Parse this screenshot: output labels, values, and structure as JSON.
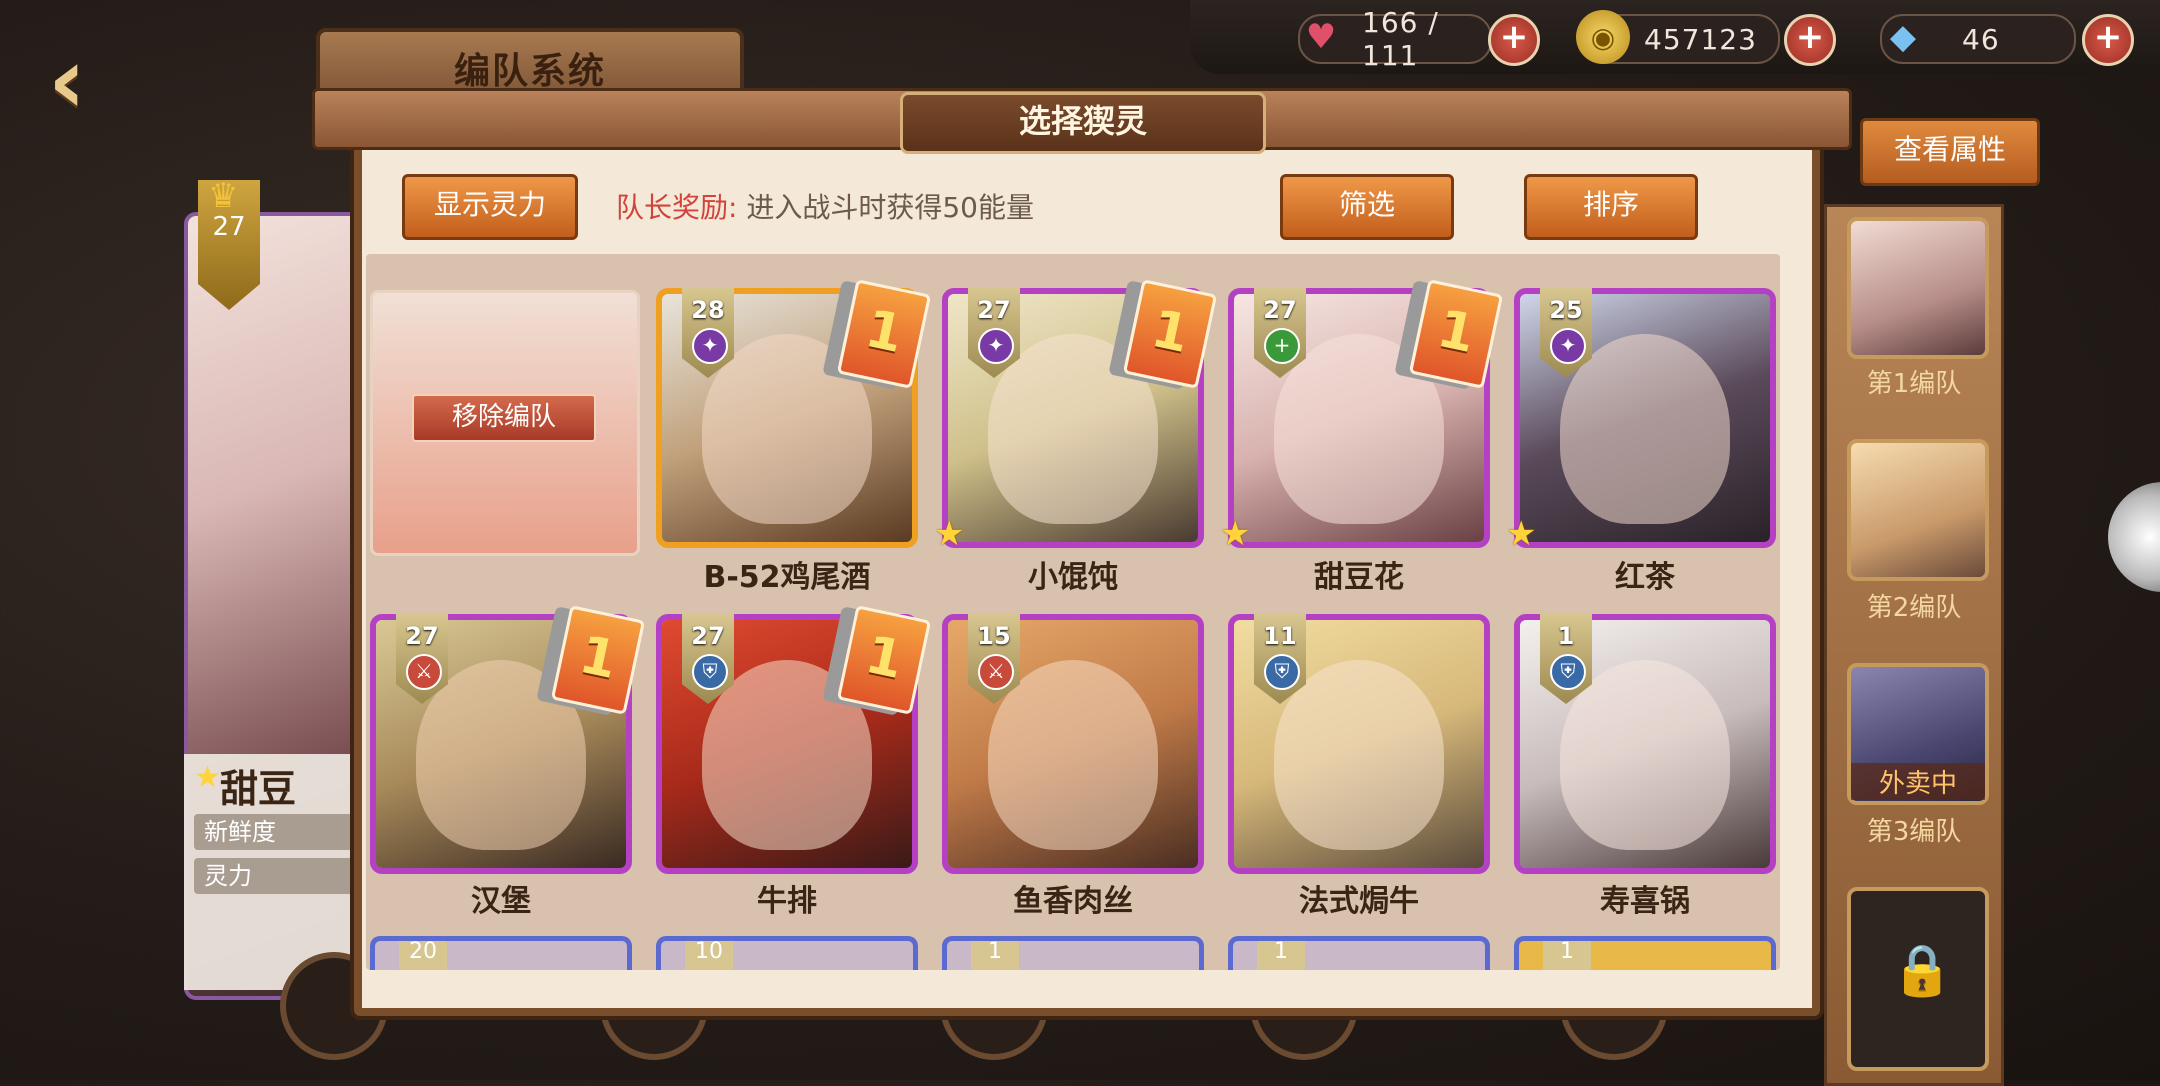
{
  "header": {
    "screen_title": "编队系统",
    "resources": [
      {
        "icon": "heart-icon",
        "value": "166 / 111"
      },
      {
        "icon": "gold-coin-icon",
        "value": "457123"
      },
      {
        "icon": "crystal-icon",
        "value": "46"
      }
    ]
  },
  "left_card": {
    "level": "27",
    "name": "甜豆",
    "stat1_label": "新鲜度",
    "stat2_label": "灵力"
  },
  "panel": {
    "title": "选择猰灵",
    "show_power_label": "显示灵力",
    "leader_bonus_label": "队长奖励:",
    "leader_bonus_text": "进入战斗时获得50能量",
    "filter_label": "筛选",
    "sort_label": "排序",
    "remove_label": "移除编队"
  },
  "characters": [
    {
      "name": "B-52鸡尾酒",
      "level": "28",
      "class": "purple",
      "deck": "1",
      "star": false,
      "frame": "gold"
    },
    {
      "name": "小馄饨",
      "level": "27",
      "class": "purple",
      "deck": "1",
      "star": true,
      "frame": "purple"
    },
    {
      "name": "甜豆花",
      "level": "27",
      "class": "green",
      "deck": "1",
      "star": true,
      "frame": "purple"
    },
    {
      "name": "红茶",
      "level": "25",
      "class": "purple",
      "deck": "",
      "star": true,
      "frame": "purple"
    },
    {
      "name": "汉堡",
      "level": "27",
      "class": "red",
      "deck": "1",
      "star": false,
      "frame": "purple"
    },
    {
      "name": "牛排",
      "level": "27",
      "class": "blue",
      "deck": "1",
      "star": false,
      "frame": "purple"
    },
    {
      "name": "鱼香肉丝",
      "level": "15",
      "class": "red",
      "deck": "",
      "star": false,
      "frame": "purple"
    },
    {
      "name": "法式焗牛",
      "level": "11",
      "class": "blue",
      "deck": "",
      "star": false,
      "frame": "purple"
    },
    {
      "name": "寿喜锅",
      "level": "1",
      "class": "blue",
      "deck": "",
      "star": false,
      "frame": "purple"
    }
  ],
  "next_row_levels": [
    "20",
    "10",
    "1",
    "1",
    "1"
  ],
  "team": {
    "view_attributes_label": "查看属性",
    "teams": [
      {
        "label": "第1编队",
        "status": ""
      },
      {
        "label": "第2编队",
        "status": ""
      },
      {
        "label": "第3编队",
        "status": "外卖中"
      }
    ]
  },
  "colors": {
    "accent": "#e07a30",
    "frame_purple": "#b441c4",
    "frame_gold": "#f0a020",
    "bonus_red": "#d0443a"
  }
}
